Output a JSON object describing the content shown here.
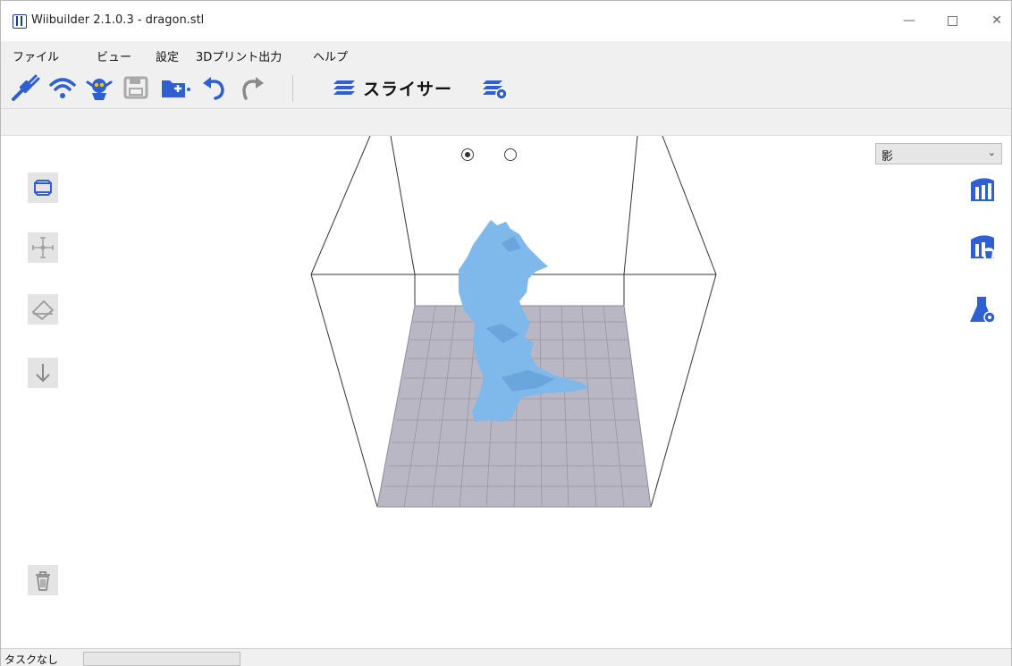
{
  "window": {
    "title": "Wiibuilder 2.1.0.3 - dragon.stl",
    "controls": {
      "minimize": "—",
      "close": "✕"
    }
  },
  "menubar": {
    "items": [
      "ファイル",
      "ビュー",
      "設定",
      "3Dプリント出力",
      "ヘルプ"
    ]
  },
  "toolbar": {
    "buttons": [
      {
        "icon": "connect-cable-icon"
      },
      {
        "icon": "wifi-icon"
      },
      {
        "icon": "robot-mascot-icon"
      },
      {
        "icon": "save-icon"
      },
      {
        "icon": "open-folder-icon"
      },
      {
        "icon": "undo-icon"
      },
      {
        "icon": "redo-icon"
      },
      {
        "icon": "slicer-layers-icon"
      },
      {
        "icon": "slicer-settings-icon"
      }
    ],
    "slicer_label": "スライサー"
  },
  "viewport": {
    "view_mode_selected": 0,
    "render_mode": {
      "selected": "影",
      "arrow": "⌄"
    },
    "left_tools": [
      "view-box-icon",
      "move-crosshair-icon",
      "rotate-plane-icon",
      "drop-to-bed-icon",
      "delete-trash-icon"
    ],
    "right_tools": [
      "scale-chart-icon",
      "support-remove-icon",
      "flask-settings-icon"
    ],
    "model": {
      "name": "dragon.stl",
      "color": "#7fb8ea"
    },
    "bed": {
      "color": "#b8b6c2",
      "grid_color": "#8e8c9a"
    }
  },
  "status": {
    "text": "タスクなし"
  },
  "colors": {
    "accent": "#2f5fd0",
    "chrome": "#f0f0f0"
  }
}
